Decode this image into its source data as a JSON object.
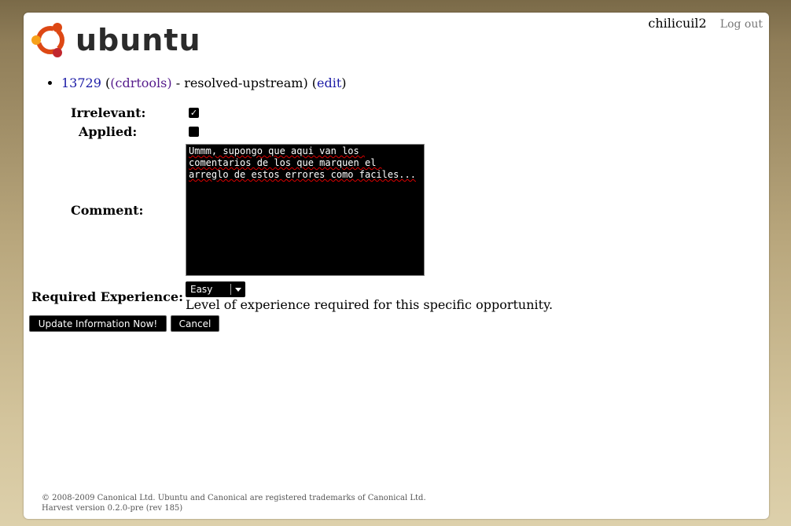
{
  "header": {
    "brand": "ubuntu",
    "username": "chilicuil2",
    "logout_label": "Log out"
  },
  "opportunity": {
    "id": "13729",
    "open_paren": "(",
    "package": "(cdrtools)",
    "status": " - resolved-upstream)",
    "edit_open": "(",
    "edit_label": "edit",
    "edit_close": ")"
  },
  "form": {
    "irrelevant_label": "Irrelevant:",
    "irrelevant_checked": true,
    "applied_label": "Applied:",
    "applied_checked": false,
    "comment_label": "Comment:",
    "comment_value": "Ummm, supongo que aqui van los comentarios de los que marquen el arreglo de estos errores como faciles...",
    "experience_label": "Required Experience:",
    "experience_value": "Easy",
    "experience_help": "Level of experience required for this specific opportunity.",
    "submit_label": "Update Information Now!",
    "cancel_label": "Cancel"
  },
  "footer": {
    "copyright": "© 2008-2009 Canonical Ltd. Ubuntu and Canonical are registered trademarks of Canonical Ltd.",
    "version": "Harvest version 0.2.0-pre (rev 185)"
  },
  "colors": {
    "ubuntu_orange": "#dd4814",
    "ubuntu_red": "#c1272d",
    "ubuntu_yellow": "#f7a11a",
    "link_blue": "#1a1aa6",
    "link_visited": "#551a8b"
  },
  "icons": {
    "logo": "ubuntu-circle-of-friends-icon",
    "checkbox_checked": "check-icon",
    "dropdown": "chevron-down-icon"
  }
}
